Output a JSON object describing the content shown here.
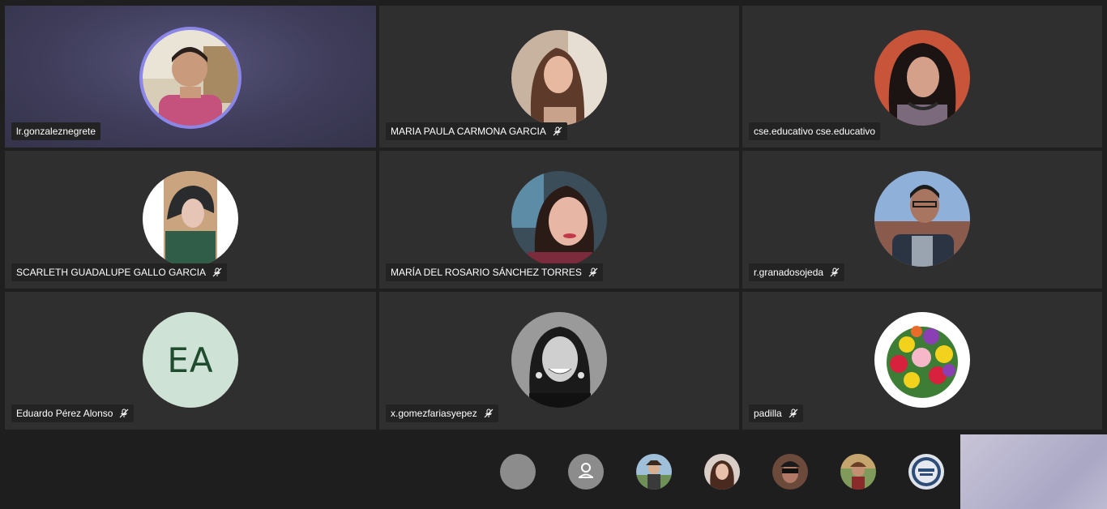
{
  "participants": [
    {
      "name": "lr.gonzaleznegrete",
      "muted": false,
      "speaking": true
    },
    {
      "name": "MARIA PAULA CARMONA GARCIA",
      "muted": true
    },
    {
      "name": "cse.educativo cse.educativo",
      "muted": false
    },
    {
      "name": "SCARLETH GUADALUPE GALLO GARCIA",
      "muted": true
    },
    {
      "name": "MARÍA DEL ROSARIO SÁNCHEZ TORRES",
      "muted": true
    },
    {
      "name": "r.granadosojeda",
      "muted": true
    },
    {
      "name": "Eduardo Pérez Alonso",
      "muted": true,
      "initials": "EA"
    },
    {
      "name": "x.gomezfariasyepez",
      "muted": true
    },
    {
      "name": "padilla",
      "muted": true
    }
  ],
  "overflow_strip": {
    "avatar_icons": [
      "blank-avatar-icon",
      "person-avatar-icon",
      "photo-avatar",
      "photo-avatar",
      "photo-avatar",
      "photo-avatar",
      "logo-avatar"
    ]
  },
  "colors": {
    "tile": "#2f2f2f",
    "speaking_ring": "#8b86ea",
    "nametag_bg": "#232323",
    "initials_bg": "#cfe2d6",
    "initials_fg": "#1f4b2f"
  }
}
